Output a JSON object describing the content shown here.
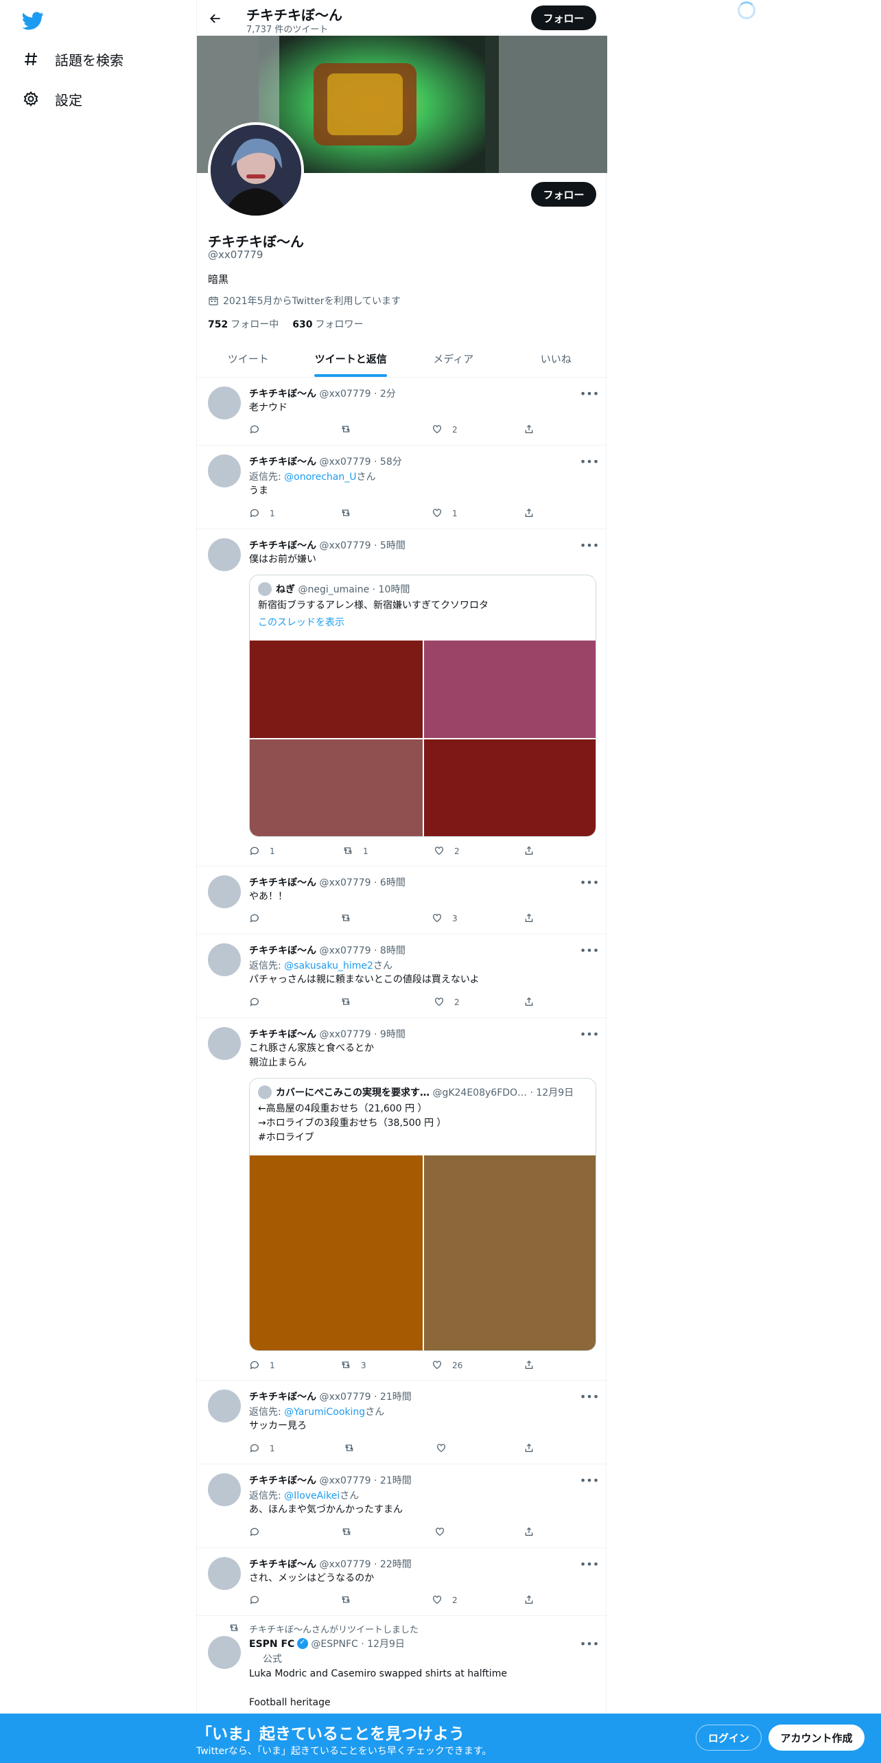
{
  "nav": {
    "items": [
      {
        "label": "話題を検索",
        "icon": "hashtag-icon"
      },
      {
        "label": "設定",
        "icon": "gear-icon"
      }
    ]
  },
  "header": {
    "name": "チキチキぼ〜ん",
    "tweet_count": "7,737 件のツイート",
    "follow_label": "フォロー"
  },
  "profile": {
    "name": "チキチキぼ〜ん",
    "handle": "@xx07779",
    "bio": "暗黒",
    "joined": "2021年5月からTwitterを利用しています",
    "following_count": "752",
    "following_label": "フォロー中",
    "followers_count": "630",
    "followers_label": "フォロワー",
    "follow_label": "フォロー"
  },
  "tabs": [
    {
      "label": "ツイート"
    },
    {
      "label": "ツイートと返信"
    },
    {
      "label": "メディア"
    },
    {
      "label": "いいね"
    }
  ],
  "tweets": [
    {
      "name": "チキチキぼ〜ん",
      "meta": "@xx07779 · 2分",
      "text": "老ナウド",
      "reply": "",
      "replies": "",
      "retweets": "",
      "likes": "2"
    },
    {
      "name": "チキチキぼ〜ん",
      "meta": "@xx07779 · 58分",
      "reply_prefix": "返信先: ",
      "reply_to": "@onorechan_U",
      "reply_suffix": "さん",
      "text": "うま",
      "replies": "1",
      "retweets": "",
      "likes": "1"
    },
    {
      "name": "チキチキぼ〜ん",
      "meta": "@xx07779 · 5時間",
      "text": "僕はお前が嫌い",
      "replies": "1",
      "retweets": "1",
      "likes": "2",
      "quote": {
        "name": "ねぎ",
        "meta": "@negi_umaine · 10時間",
        "text": "新宿街ブラするアレン様、新宿嫌いすぎてクソワロタ",
        "link": "このスレッドを表示",
        "image_colors": [
          "#7d1a16",
          "#9c4468",
          "#915050",
          "#7e1817"
        ]
      }
    },
    {
      "name": "チキチキぼ〜ん",
      "meta": "@xx07779 · 6時間",
      "text": "やあ！！",
      "replies": "",
      "retweets": "",
      "likes": "3"
    },
    {
      "name": "チキチキぼ〜ん",
      "meta": "@xx07779 · 8時間",
      "reply_prefix": "返信先: ",
      "reply_to": "@sakusaku_hime2",
      "reply_suffix": "さん",
      "text": "パチャっさんは親に頼まないとこの値段は買えないよ",
      "replies": "",
      "retweets": "",
      "likes": "2"
    },
    {
      "name": "チキチキぼ〜ん",
      "meta": "@xx07779 · 9時間",
      "text": "これ豚さん家族と食べるとか\n親泣止まらん",
      "replies": "1",
      "retweets": "3",
      "likes": "26",
      "quote": {
        "name": "カバーにぺこみこの実現を要求す…",
        "meta": "@gK24E08y6FDO… · 12月9日",
        "text": "←高島屋の4段重おせち（21,600 円 ）\n→ホロライブの3段重おせち（38,500 円 ）\n#ホロライブ",
        "image_colors": [
          "#a65a02",
          "#8b6739"
        ]
      }
    },
    {
      "name": "チキチキぼ〜ん",
      "meta": "@xx07779 · 21時間",
      "reply_prefix": "返信先: ",
      "reply_to": "@YarumiCooking",
      "reply_suffix": "さん",
      "text": "サッカー見ろ",
      "replies": "1",
      "retweets": "",
      "likes": ""
    },
    {
      "name": "チキチキぼ〜ん",
      "meta": "@xx07779 · 21時間",
      "reply_prefix": "返信先: ",
      "reply_to": "@IloveAikei",
      "reply_suffix": "さん",
      "text": "あ、ほんまや気づかんかったすまん",
      "replies": "",
      "retweets": "",
      "likes": ""
    },
    {
      "name": "チキチキぼ〜ん",
      "meta": "@xx07779 · 22時間",
      "text": "され、メッシはどうなるのか",
      "replies": "",
      "retweets": "",
      "likes": "2"
    },
    {
      "retweeted_by": "チキチキぼ〜んさんがリツイートしました",
      "name": "ESPN FC",
      "meta": "@ESPNFC · 12月9日",
      "label": "公式",
      "text": "Luka Modric and Casemiro swapped shirts at halftime\n\nFootball heritage"
    }
  ],
  "bottom": {
    "title": "「いま」起きていることを見つけよう",
    "subtitle": "Twitterなら、「いま」起きていることをいち早くチェックできます。",
    "login": "ログイン",
    "signup": "アカウント作成"
  },
  "colors": {
    "accent": "#1d9bf0",
    "text": "#0f1419",
    "muted": "#536471"
  }
}
